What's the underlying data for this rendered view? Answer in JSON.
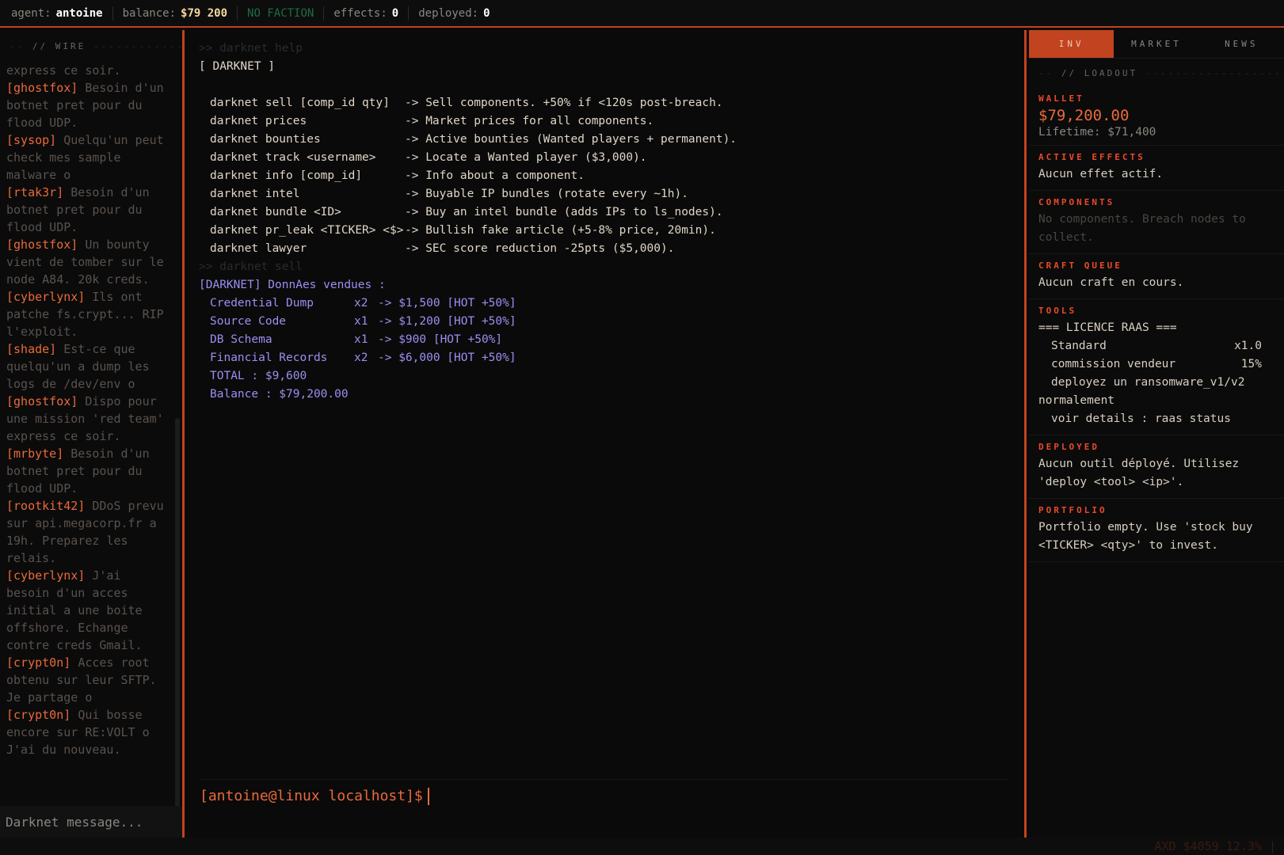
{
  "topbar": {
    "agent_key": "agent:",
    "agent_val": "antoine",
    "balance_key": "balance:",
    "balance_val": "$79 200",
    "faction": "NO FACTION",
    "effects_key": "effects:",
    "effects_val": "0",
    "deployed_key": "deployed:",
    "deployed_val": "0"
  },
  "wire": {
    "title": "// WIRE",
    "input_placeholder": "Darknet message...",
    "messages": [
      {
        "user": "",
        "text": "express ce soir."
      },
      {
        "user": "[ghostfox]",
        "text": "Besoin d'un botnet pret pour du flood UDP."
      },
      {
        "user": "[sysop]",
        "text": "Quelqu'un peut check mes sample malware o"
      },
      {
        "user": "[rtak3r]",
        "text": "Besoin d'un botnet pret pour du flood UDP."
      },
      {
        "user": "[ghostfox]",
        "text": "Un bounty vient de tomber sur le node A84. 20k creds."
      },
      {
        "user": "[cyberlynx]",
        "text": "Ils ont patche fs.crypt... RIP l'exploit."
      },
      {
        "user": "[shade]",
        "text": "Est-ce que quelqu'un a dump les logs de /dev/env o"
      },
      {
        "user": "[ghostfox]",
        "text": "Dispo pour une mission 'red team' express ce soir."
      },
      {
        "user": "[mrbyte]",
        "text": "Besoin d'un botnet pret pour du flood UDP."
      },
      {
        "user": "[rootkit42]",
        "text": "DDoS prevu sur api.megacorp.fr a 19h. Preparez les relais."
      },
      {
        "user": "[cyberlynx]",
        "text": "J'ai besoin d'un acces initial a une boite offshore. Echange contre creds Gmail."
      },
      {
        "user": "[crypt0n]",
        "text": "Acces root obtenu sur leur SFTP. Je partage o"
      },
      {
        "user": "[crypt0n]",
        "text": "Qui bosse encore sur RE:VOLT o J'ai du nouveau."
      }
    ]
  },
  "terminal": {
    "ghost_cmd1": ">> darknet help",
    "header": "[ DARKNET ]",
    "help_rows": [
      {
        "cmd": "darknet sell [comp_id qty]",
        "desc": "-> Sell components. +50% if <120s post-breach."
      },
      {
        "cmd": "darknet prices",
        "desc": "-> Market prices for all components."
      },
      {
        "cmd": "darknet bounties",
        "desc": "-> Active bounties (Wanted players + permanent)."
      },
      {
        "cmd": "darknet track <username>",
        "desc": "-> Locate a Wanted player ($3,000)."
      },
      {
        "cmd": "darknet info [comp_id]",
        "desc": "-> Info about a component."
      },
      {
        "cmd": "darknet intel",
        "desc": "-> Buyable IP bundles (rotate every ~1h)."
      },
      {
        "cmd": "darknet bundle <ID>",
        "desc": "-> Buy an intel bundle (adds IPs to ls_nodes)."
      },
      {
        "cmd": "darknet pr_leak <TICKER> <$>",
        "desc": "-> Bullish fake article (+5-8% price, 20min)."
      },
      {
        "cmd": "darknet lawyer",
        "desc": "-> SEC score reduction -25pts ($5,000)."
      }
    ],
    "ghost_cmd2": ">> darknet sell",
    "sold_header": "[DARKNET] DonnAes vendues :",
    "sold_rows": [
      {
        "name": "Credential Dump",
        "qty": "x2",
        "price": "-> $1,500 [HOT +50%]"
      },
      {
        "name": "Source Code",
        "qty": "x1",
        "price": "-> $1,200 [HOT +50%]"
      },
      {
        "name": "DB Schema",
        "qty": "x1",
        "price": "-> $900 [HOT +50%]"
      },
      {
        "name": "Financial Records",
        "qty": "x2",
        "price": "-> $6,000 [HOT +50%]"
      }
    ],
    "total": "TOTAL : $9,600",
    "balance": "Balance : $79,200.00",
    "prompt": "[antoine@linux localhost]$"
  },
  "right": {
    "tabs": [
      {
        "label": "INV",
        "active": true
      },
      {
        "label": "MARKET",
        "active": false
      },
      {
        "label": "NEWS",
        "active": false
      }
    ],
    "loadout_title": "// LOADOUT",
    "wallet": {
      "title": "WALLET",
      "amount": "$79,200.00",
      "lifetime": "Lifetime: $71,400"
    },
    "effects": {
      "title": "ACTIVE EFFECTS",
      "text": "Aucun effet actif."
    },
    "components": {
      "title": "COMPONENTS",
      "text": "No components. Breach nodes to collect."
    },
    "craft": {
      "title": "CRAFT QUEUE",
      "text": "Aucun craft en cours."
    },
    "tools": {
      "title": "TOOLS",
      "licence": "=== LICENCE RAAS ===",
      "rows": [
        {
          "k": "Standard",
          "v": "x1.0"
        },
        {
          "k": "commission vendeur",
          "v": "15%"
        }
      ],
      "line3": "deployez un ransomware_v1/v2",
      "line4": "normalement",
      "line5": "voir details : raas status"
    },
    "deployed": {
      "title": "DEPLOYED",
      "text": "Aucun outil déployé. Utilisez 'deploy <tool> <ip>'."
    },
    "portfolio": {
      "title": "PORTFOLIO",
      "text": "Portfolio empty. Use 'stock buy <TICKER> <qty>' to invest."
    }
  },
  "ticker": "AXD $4059 12.3% |",
  "colors": {
    "accent": "#c2431f",
    "orange": "#ea6a3a",
    "purple": "#9a90f0",
    "faction": "#1f6b47"
  }
}
